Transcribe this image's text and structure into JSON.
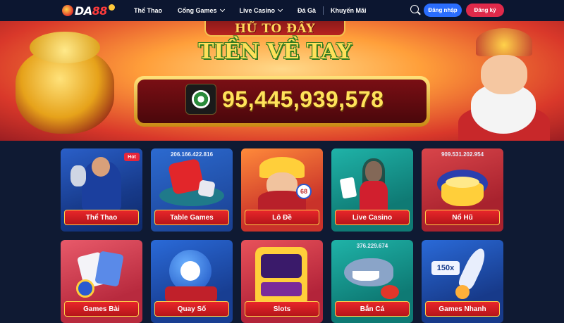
{
  "header": {
    "logo_main": "DA",
    "logo_accent": "88",
    "nav": [
      {
        "label": "Thể Thao",
        "dropdown": false
      },
      {
        "label": "Cổng Games",
        "dropdown": true
      },
      {
        "label": "Live Casino",
        "dropdown": true
      },
      {
        "label": "Đá Gà",
        "dropdown": false
      },
      {
        "label": "Khuyến Mãi",
        "dropdown": false
      }
    ],
    "login_label": "Đăng nhập",
    "register_label": "Đăng ký",
    "colors": {
      "login": "#2a6dff",
      "register": "#e0294a",
      "background": "#0c1630"
    }
  },
  "banner": {
    "title_line1": "HŨ TO ĐÂY",
    "title_line2": "TIỀN VỀ TAY",
    "jackpot_value": "95,445,939,578"
  },
  "games": [
    {
      "label": "Thể Thao",
      "badge": "Hot",
      "counter": ""
    },
    {
      "label": "Table Games",
      "badge": "",
      "counter": "206.166.422.816"
    },
    {
      "label": "Lô Đề",
      "badge": "",
      "counter": ""
    },
    {
      "label": "Live Casino",
      "badge": "",
      "counter": ""
    },
    {
      "label": "Nổ Hũ",
      "badge": "",
      "counter": "909.531.202.954"
    },
    {
      "label": "Games Bài",
      "badge": "",
      "counter": ""
    },
    {
      "label": "Quay Số",
      "badge": "",
      "counter": ""
    },
    {
      "label": "Slots",
      "badge": "",
      "counter": ""
    },
    {
      "label": "Bắn Cá",
      "badge": "",
      "counter": "376.229.674"
    },
    {
      "label": "Games Nhanh",
      "badge": "",
      "counter": ""
    }
  ],
  "art_text": {
    "lode_ball": "68",
    "multiplier": "150x"
  }
}
